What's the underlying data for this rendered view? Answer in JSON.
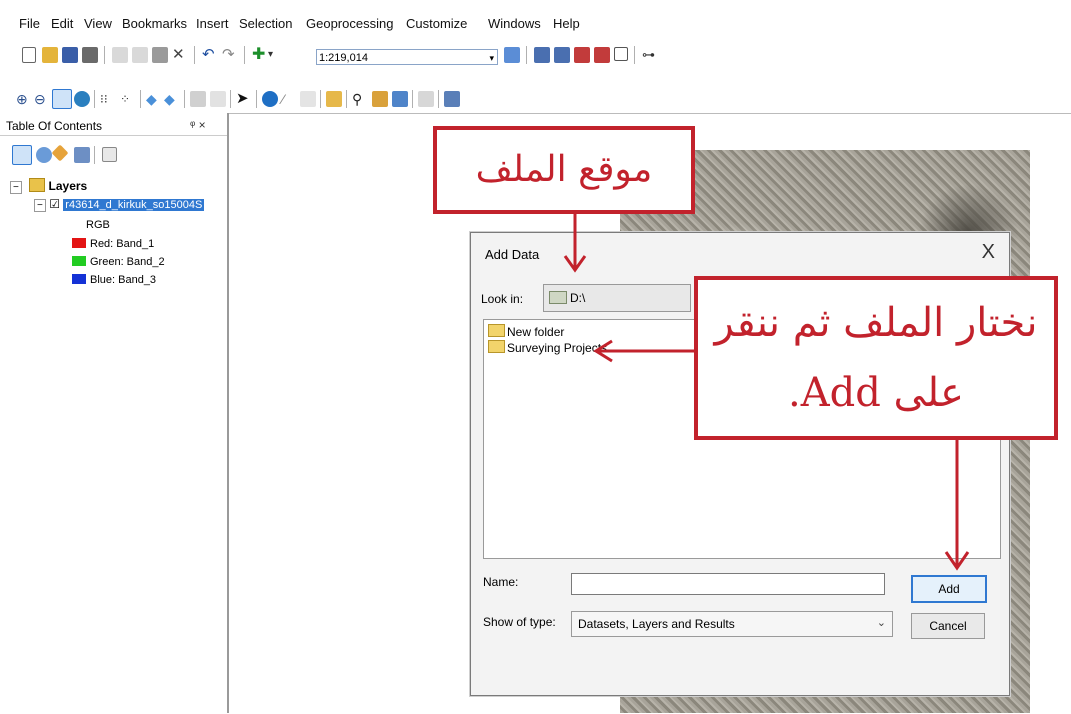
{
  "menu": [
    "File",
    "Edit",
    "View",
    "Bookmarks",
    "Insert",
    "Selection",
    "Geoprocessing",
    "Customize",
    "Windows",
    "Help"
  ],
  "toolbar": {
    "scale": "1:219,014"
  },
  "toc": {
    "title": "Table Of Contents",
    "pin": "ᵠ ×",
    "layers_label": "Layers",
    "layer_name": "r43614_d_kirkuk_so15004S",
    "rgb_label": "RGB",
    "bands": [
      {
        "label": "Red:  Band_1",
        "color": "#e31414"
      },
      {
        "label": "Green: Band_2",
        "color": "#22cc22"
      },
      {
        "label": "Blue:  Band_3",
        "color": "#1432d6"
      }
    ]
  },
  "dialog": {
    "title": "Add Data",
    "close": "X",
    "lookin_label": "Look in:",
    "lookin_value": "D:\\",
    "files": [
      "New folder",
      "Surveying Projects"
    ],
    "name_label": "Name:",
    "name_value": "",
    "type_label": "Show of type:",
    "type_value": "Datasets, Layers and Results",
    "add_button": "Add",
    "cancel_button": "Cancel"
  },
  "callouts": {
    "file_location": "موقع الملف",
    "choose_line1": "نختار الملف ثم ننقر",
    "choose_line2": "على Add."
  },
  "colors": {
    "callout": "#c2222c",
    "selection": "#2f78d1"
  }
}
